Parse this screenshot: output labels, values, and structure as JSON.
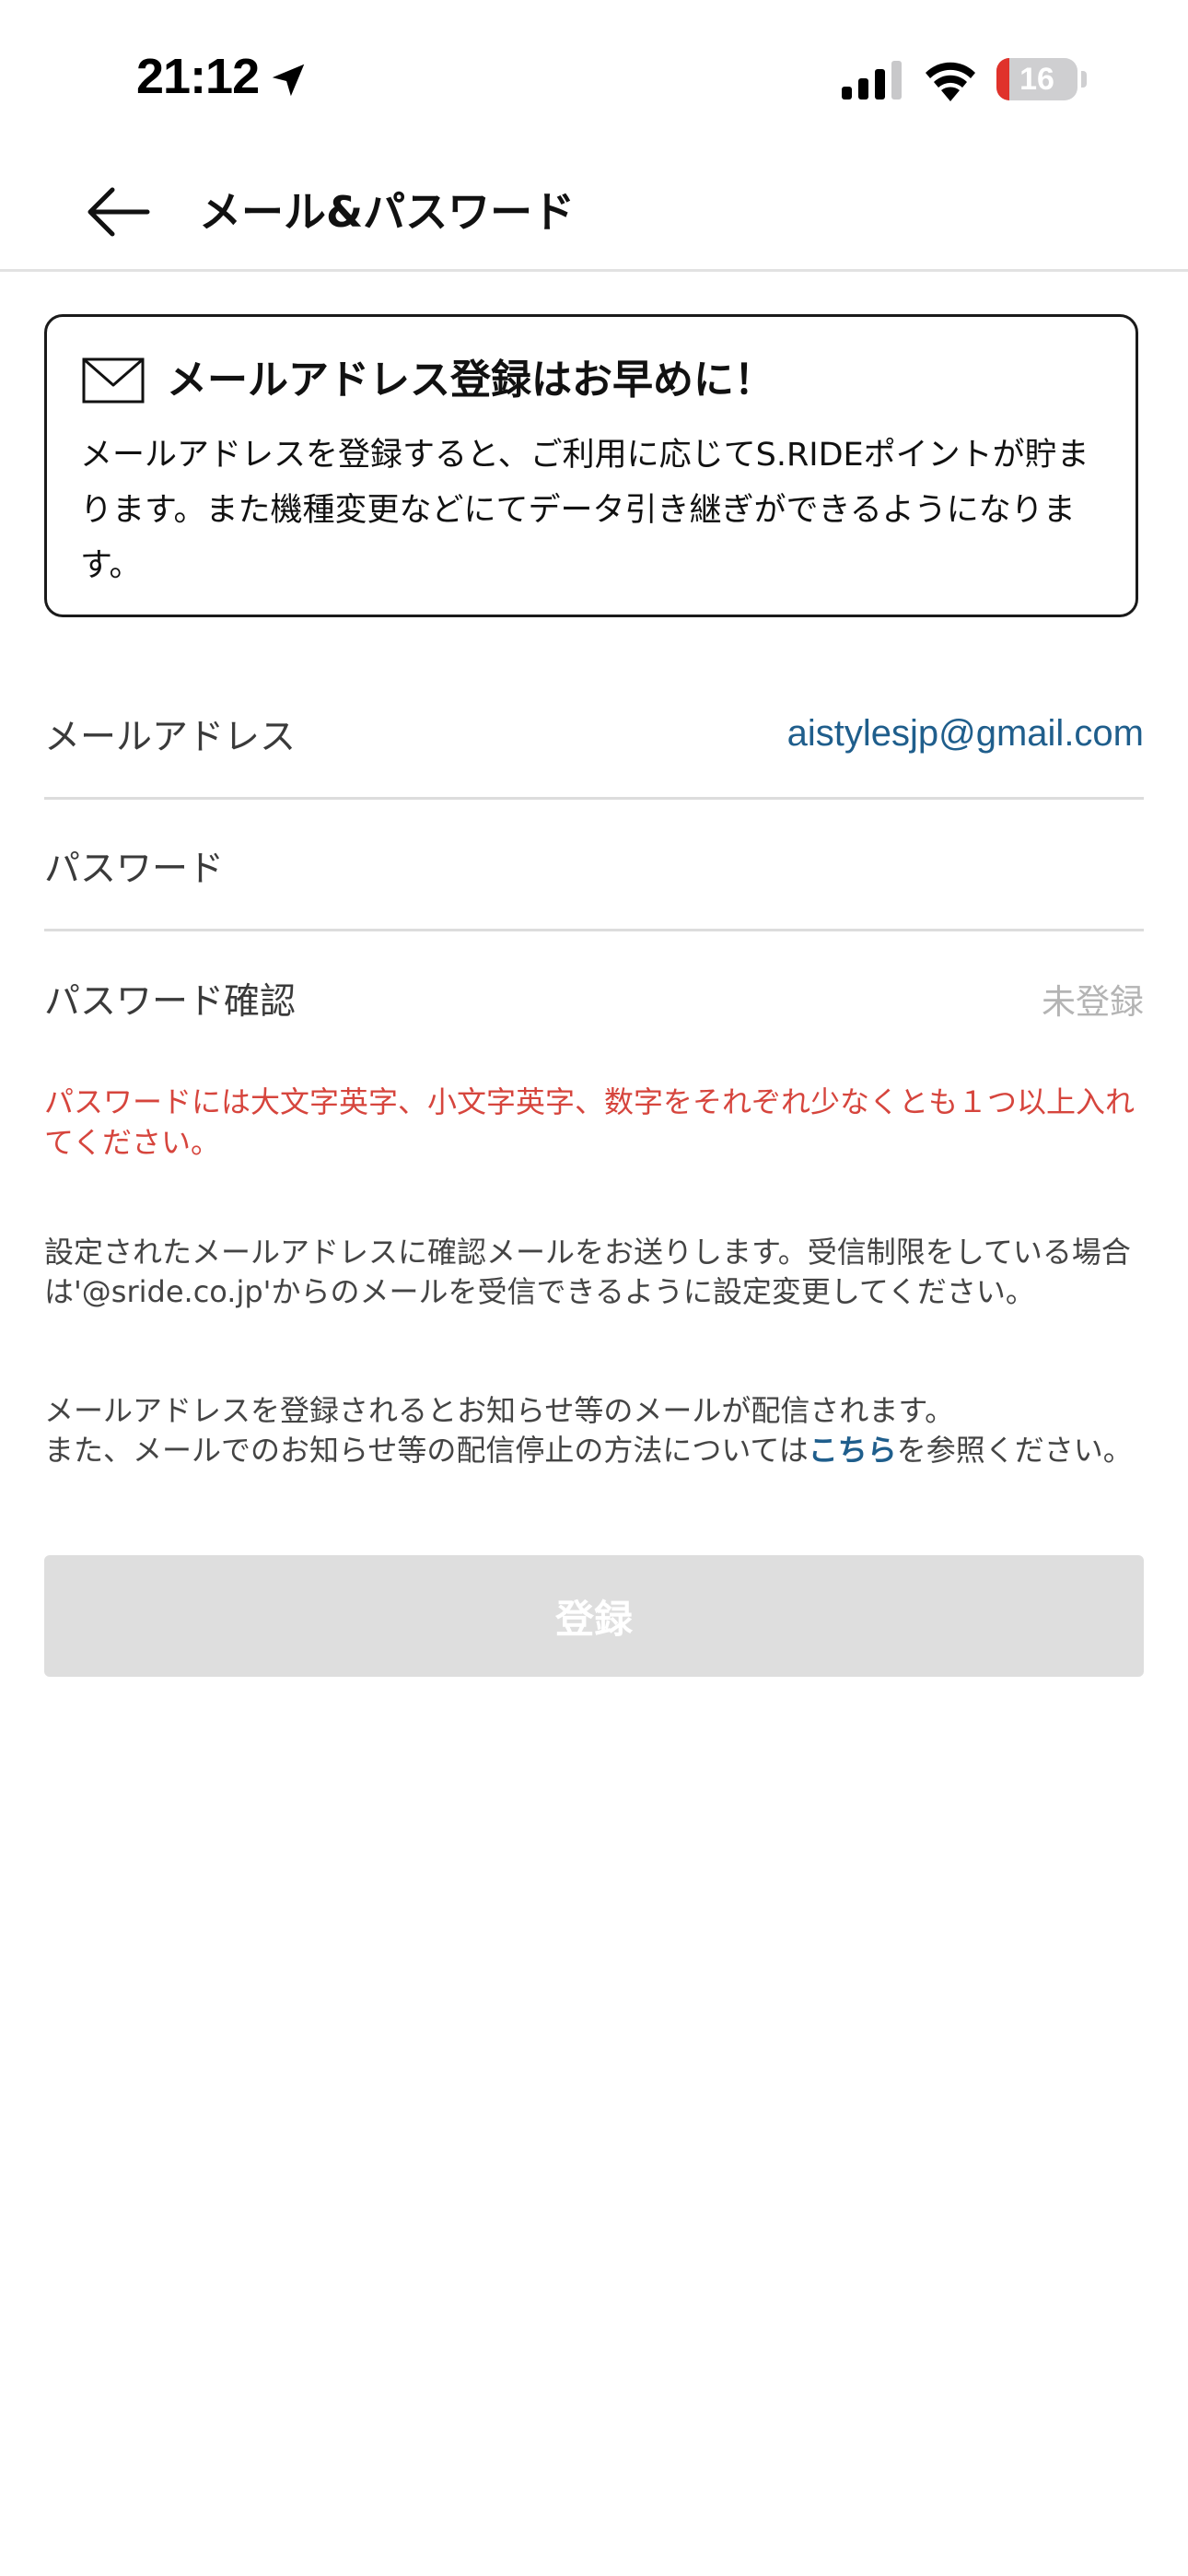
{
  "status_bar": {
    "time": "21:12",
    "battery_level": "16",
    "battery_fraction": 0.16,
    "battery_color": "#e0322b",
    "icons": [
      "location-arrow-icon",
      "cellular-signal-icon",
      "wifi-icon",
      "battery-icon"
    ]
  },
  "nav": {
    "title": "メール&パスワード",
    "back_icon": "arrow-left-icon"
  },
  "info_card": {
    "icon": "mail-icon",
    "title": "メールアドレス登録はお早めに！",
    "body": "メールアドレスを登録すると、ご利用に応じてS.RIDEポイントが貯まります。また機種変更などにてデータ引き継ぎができるようになります。"
  },
  "form": {
    "email": {
      "label": "メールアドレス",
      "value": "aistylesjp@gmail.com"
    },
    "password": {
      "label": "パスワード",
      "value": ""
    },
    "password_confirm": {
      "label": "パスワード確認",
      "value": "未登録"
    }
  },
  "error_message": "パスワードには大文字英字、小文字英字、数字をそれぞれ少なくとも１つ以上入れてください。",
  "notices": {
    "confirmation": "設定されたメールアドレスに確認メールをお送りします。受信制限をしている場合は'@sride.co.jp'からのメールを受信できるように設定変更してください。",
    "delivery_line1": "メールアドレスを登録されるとお知らせ等のメールが配信されます。",
    "delivery_line2_prefix": "また、メールでのお知らせ等の配信停止の方法については",
    "delivery_link": "こちら",
    "delivery_line2_suffix": "を参照ください。"
  },
  "register_button": {
    "label": "登録",
    "enabled": false
  },
  "colors": {
    "accent_link": "#1f5e8c",
    "error": "#d6453d",
    "disabled_button": "#dedede",
    "divider": "#dcdcdc",
    "placeholder": "#b4b4b4"
  }
}
